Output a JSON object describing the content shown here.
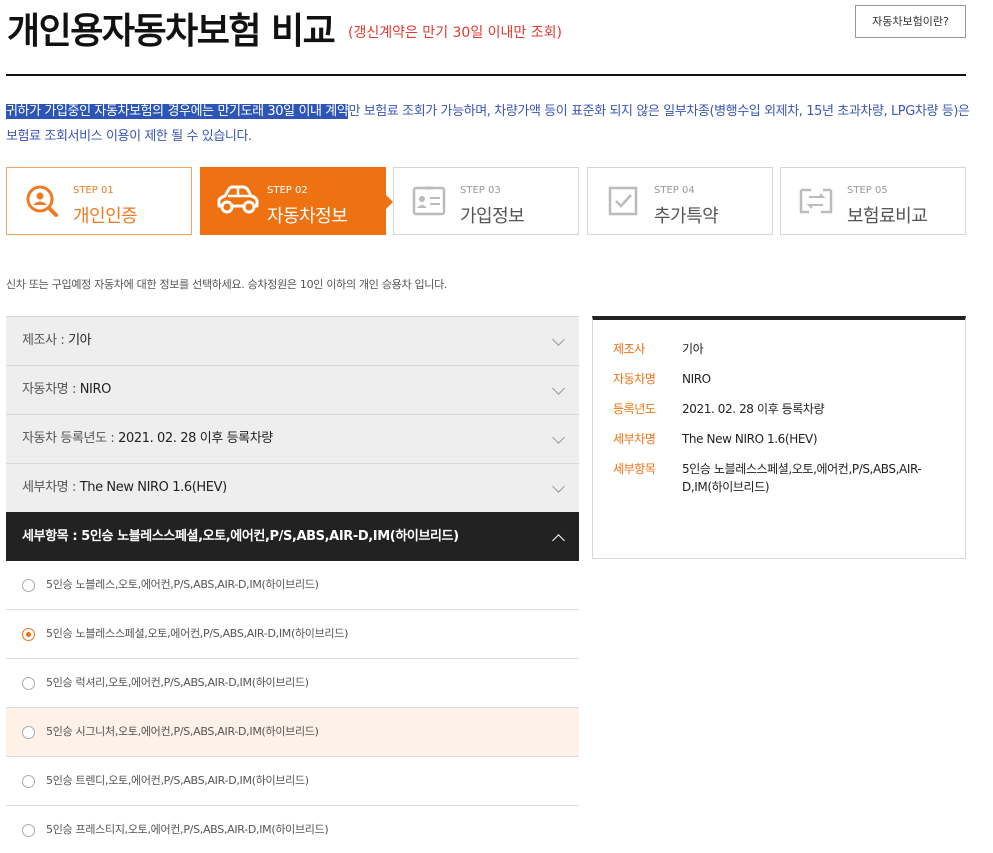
{
  "header": {
    "title": "개인용자동차보험 비교",
    "note": "(갱신계약은 만기 30일 이내만 조회)",
    "help_button": "자동차보험이란?"
  },
  "notice": {
    "highlight": "귀하가 가입중인 자동차보험의 경우에는 만기도래 30일 이내 계약",
    "rest": "만 보험료 조회가 가능하며, 차량가액 등이 표준화 되지 않은 일부차종(병행수입 외제차, 15년 초과차량, LPG차량 등)은 보험료 조회서비스 이용이 제한 될 수 있습니다."
  },
  "steps": [
    {
      "no": "STEP 01",
      "label": "개인인증",
      "icon": "person-search-icon",
      "state": "done"
    },
    {
      "no": "STEP 02",
      "label": "자동차정보",
      "icon": "car-icon",
      "state": "active"
    },
    {
      "no": "STEP 03",
      "label": "가입정보",
      "icon": "id-card-icon",
      "state": "todo"
    },
    {
      "no": "STEP 04",
      "label": "추가특약",
      "icon": "checkbox-icon",
      "state": "todo"
    },
    {
      "no": "STEP 05",
      "label": "보험료비교",
      "icon": "compare-icon",
      "state": "todo"
    }
  ],
  "guide": "신차 또는 구입예정 자동차에 대한 정보를 선택하세요. 승차정원은 10인 이하의 개인 승용차 입니다.",
  "accordion": [
    {
      "key": "제조사 : ",
      "value": "기아"
    },
    {
      "key": "자동차명 : ",
      "value": "NIRO"
    },
    {
      "key": "자동차 등록년도 : ",
      "value": "2021. 02. 28 이후 등록차량"
    },
    {
      "key": "세부차명 : ",
      "value": "The New NIRO 1.6(HEV)"
    },
    {
      "key": "세부항목 : ",
      "value": "5인승 노블레스스페셜,오토,에어컨,P/S,ABS,AIR-D,IM(하이브리드)"
    }
  ],
  "options": [
    "5인승 노블레스,오토,에어컨,P/S,ABS,AIR-D,IM(하이브리드)",
    "5인승 노블레스스페셜,오토,에어컨,P/S,ABS,AIR-D,IM(하이브리드)",
    "5인승 럭셔리,오토,에어컨,P/S,ABS,AIR-D,IM(하이브리드)",
    "5인승 시그니처,오토,에어컨,P/S,ABS,AIR-D,IM(하이브리드)",
    "5인승 트렌디,오토,에어컨,P/S,ABS,AIR-D,IM(하이브리드)",
    "5인승 프레스티지,오토,에어컨,P/S,ABS,AIR-D,IM(하이브리드)"
  ],
  "selected_option_index": 1,
  "summary": [
    {
      "key": "제조사",
      "value": "기아"
    },
    {
      "key": "자동차명",
      "value": "NIRO"
    },
    {
      "key": "등록년도",
      "value": "2021. 02. 28 이후 등록차량"
    },
    {
      "key": "세부차명",
      "value": "The New NIRO 1.6(HEV)"
    },
    {
      "key": "세부항목",
      "value": "5인승 노블레스스페셜,오토,에어컨,P/S,ABS,AIR-D,IM(하이브리드)"
    }
  ],
  "colors": {
    "accent": "#ee7212",
    "notice": "#3b57b8",
    "title_note": "#e03a2f"
  }
}
